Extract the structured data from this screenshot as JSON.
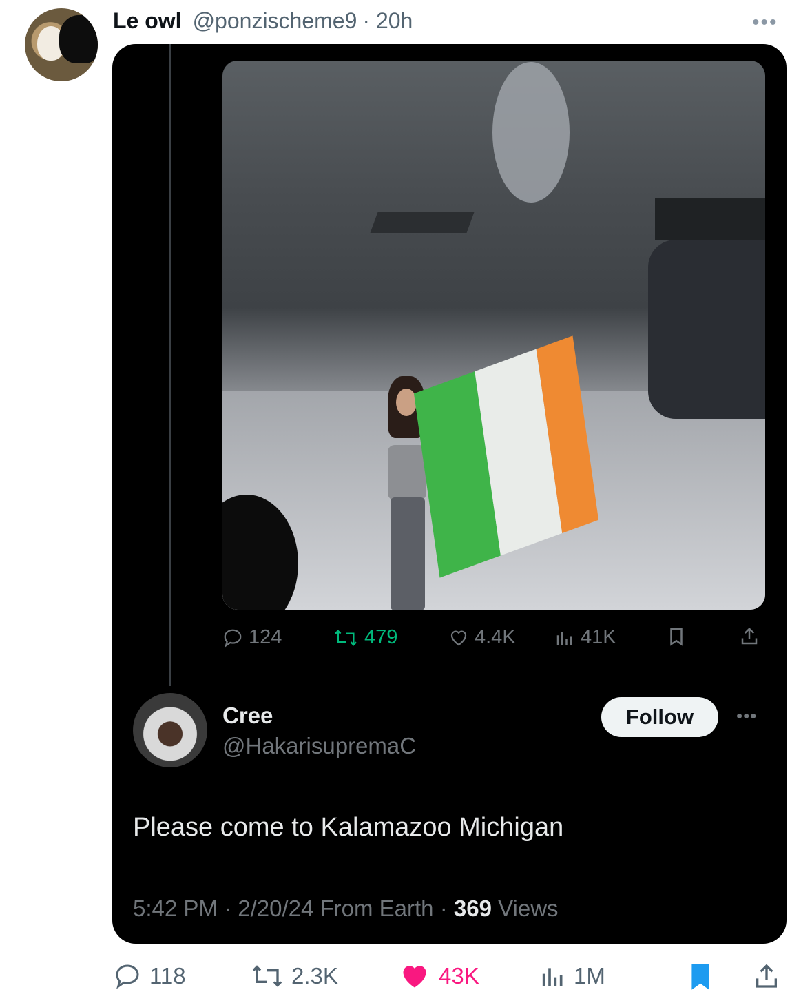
{
  "tweet": {
    "author_name": "Le owl",
    "author_handle": "@ponzischeme9",
    "time": "· 20h",
    "more_icon": "more-horizontal-icon"
  },
  "quoted": {
    "video": {
      "cc_icon": "captions-off-icon",
      "mute_icon": "volume-muted-icon"
    },
    "actions": {
      "replies": "124",
      "retweets": "479",
      "likes": "4.4K",
      "views": "41K"
    },
    "reply": {
      "name": "Cree",
      "handle": "@HakarisupremaC",
      "follow_label": "Follow",
      "text": "Please come to Kalamazoo Michigan",
      "meta_time": "5:42 PM · 2/20/24 From Earth · ",
      "meta_views_count": "369",
      "meta_views_label": " Views"
    }
  },
  "bottom_actions": {
    "replies": "118",
    "retweets": "2.3K",
    "likes": "43K",
    "views": "1M"
  },
  "colors": {
    "retweet_green": "#00ba7c",
    "like_pink": "#f91880",
    "bookmark_blue": "#1d9bf0"
  }
}
